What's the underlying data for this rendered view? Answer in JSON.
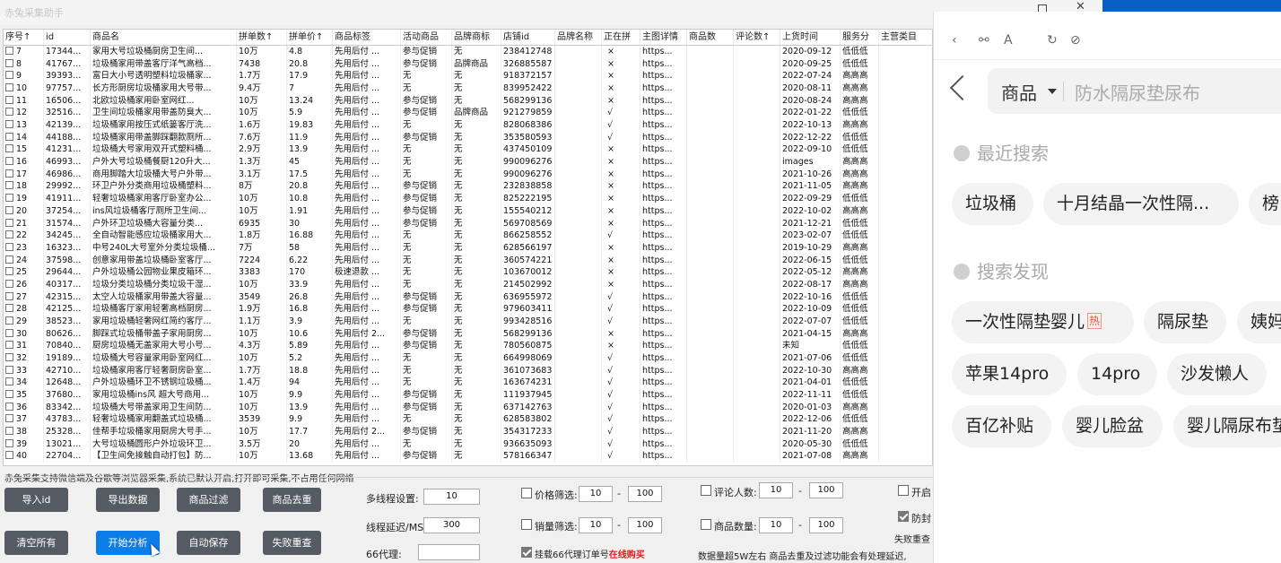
{
  "app": {
    "title": "赤兔采集助手"
  },
  "columns": [
    "序号↑",
    "id",
    "商品名",
    "拼单数↑",
    "拼单价↑",
    "商品标签",
    "活动商品",
    "品牌商标",
    "店铺id",
    "品牌名称",
    "正在拼",
    "主图详情",
    "商品数",
    "评论数↑",
    "上货时间",
    "服务分",
    "主营类目"
  ],
  "rows": [
    [
      "7",
      "17344...",
      "家用大号垃圾桶厨房卫生间...",
      "10万",
      "4.8",
      "先用后付 ...",
      "参与促销",
      "无",
      "238412748",
      "",
      "×",
      "https...",
      "",
      "",
      "2020-09-12",
      "低低低"
    ],
    [
      "8",
      "41767...",
      "垃圾桶家用带盖客厅洋气高档...",
      "7438",
      "20.8",
      "先用后付 ...",
      "参与促销",
      "品牌商品",
      "326885587",
      "",
      "×",
      "https...",
      "",
      "",
      "2020-09-25",
      "低低低"
    ],
    [
      "9",
      "39393...",
      "富日大小号透明塑料垃圾桶家...",
      "1.7万",
      "17.9",
      "先用后付 ...",
      "无",
      "无",
      "918372157",
      "",
      "×",
      "https...",
      "",
      "",
      "2022-07-24",
      "高高高"
    ],
    [
      "10",
      "97757...",
      "长方形厨房垃圾桶家用大号带...",
      "9.4万",
      "7",
      "先用后付 ...",
      "无",
      "无",
      "839952422",
      "",
      "×",
      "https...",
      "",
      "",
      "2020-08-11",
      "高高高"
    ],
    [
      "11",
      "16506...",
      "北欧垃圾桶家用卧室网红...",
      "10万",
      "13.24",
      "先用后付 ...",
      "参与促销",
      "无",
      "568299136",
      "",
      "×",
      "https...",
      "",
      "",
      "2020-08-24",
      "高高高"
    ],
    [
      "12",
      "32516...",
      "卫生间垃圾桶家用带盖防臭大...",
      "10万",
      "5.9",
      "先用后付 ...",
      "参与促销",
      "品牌商品",
      "921279859",
      "",
      "√",
      "https...",
      "",
      "",
      "2022-01-22",
      "低低低"
    ],
    [
      "13",
      "42139...",
      "垃圾桶家用按压式纸篓客厅洗...",
      "1.6万",
      "19.83",
      "先用后付 ...",
      "无",
      "无",
      "828068386",
      "",
      "√",
      "https...",
      "",
      "",
      "2022-10-13",
      "高高高"
    ],
    [
      "14",
      "44188...",
      "垃圾桶家用带盖脚踩翻款厕所...",
      "7.6万",
      "11.9",
      "先用后付 ...",
      "参与促销",
      "无",
      "353580593",
      "",
      "√",
      "https...",
      "",
      "",
      "2022-12-22",
      "低低低"
    ],
    [
      "15",
      "41231...",
      "垃圾桶大号家用双开式塑料桶...",
      "2.9万",
      "13.9",
      "先用后付 ...",
      "无",
      "无",
      "437450109",
      "",
      "×",
      "https...",
      "",
      "",
      "2022-09-10",
      "低低低"
    ],
    [
      "16",
      "46993...",
      "户外大号垃圾桶餐厨120升大...",
      "1.3万",
      "45",
      "先用后付 ...",
      "无",
      "无",
      "990096276",
      "",
      "×",
      "https...",
      "",
      "",
      "images",
      "高高高"
    ],
    [
      "17",
      "46986...",
      "商用脚踏大垃圾桶大号户外带...",
      "3.1万",
      "17.5",
      "先用后付 ...",
      "无",
      "无",
      "990096276",
      "",
      "×",
      "https...",
      "",
      "",
      "2021-10-26",
      "高高高"
    ],
    [
      "18",
      "29992...",
      "环卫户外分类商用垃圾桶塑料...",
      "8万",
      "20.8",
      "先用后付 ...",
      "参与促销",
      "无",
      "232838858",
      "",
      "×",
      "https...",
      "",
      "",
      "2021-11-05",
      "高高高"
    ],
    [
      "19",
      "41911...",
      "轻奢垃圾桶家用客厅卧室办公...",
      "10万",
      "10.8",
      "先用后付 ...",
      "参与促销",
      "无",
      "825222195",
      "",
      "×",
      "https...",
      "",
      "",
      "2022-09-29",
      "低低低"
    ],
    [
      "20",
      "37254...",
      "ins风垃圾桶客厅厕所卫生间...",
      "10万",
      "1.91",
      "先用后付 ...",
      "参与促销",
      "无",
      "155540212",
      "",
      "×",
      "https...",
      "",
      "",
      "2022-10-02",
      "高高高"
    ],
    [
      "21",
      "31574...",
      "户外环卫垃圾桶大容量分类...",
      "6935",
      "30",
      "先用后付 ...",
      "参与促销",
      "无",
      "569708569",
      "",
      "×",
      "https...",
      "",
      "",
      "2021-12-21",
      "低低低"
    ],
    [
      "22",
      "34245...",
      "全自动智能感应垃圾桶家用大...",
      "1.8万",
      "16.88",
      "先用后付 ...",
      "无",
      "无",
      "866258552",
      "",
      "√",
      "https...",
      "",
      "",
      "2023-02-07",
      "低低低"
    ],
    [
      "23",
      "16323...",
      "中号240L大号室外分类垃圾桶...",
      "7万",
      "58",
      "先用后付 ...",
      "无",
      "无",
      "628566197",
      "",
      "×",
      "https...",
      "",
      "",
      "2019-10-29",
      "高高高"
    ],
    [
      "24",
      "37598...",
      "创意家用带盖垃圾桶卧室客厅...",
      "7224",
      "6.22",
      "先用后付 ...",
      "无",
      "无",
      "360574221",
      "",
      "×",
      "https...",
      "",
      "",
      "2022-06-15",
      "低低低"
    ],
    [
      "25",
      "29644...",
      "户外垃圾桶公园物业果皮箱环...",
      "3383",
      "170",
      "极速退款 ...",
      "无",
      "无",
      "103670012",
      "",
      "×",
      "https...",
      "",
      "",
      "2022-05-12",
      "高高高"
    ],
    [
      "26",
      "40317...",
      "垃圾分类垃圾桶分类垃圾干湿...",
      "10万",
      "33.9",
      "先用后付 ...",
      "无",
      "无",
      "214502992",
      "",
      "×",
      "https...",
      "",
      "",
      "2022-08-17",
      "高高高"
    ],
    [
      "27",
      "42315...",
      "太空人垃圾桶家用带盖大容量...",
      "3549",
      "26.8",
      "先用后付 ...",
      "参与促销",
      "无",
      "636955972",
      "",
      "√",
      "https...",
      "",
      "",
      "2022-10-16",
      "低低低"
    ],
    [
      "28",
      "42125...",
      "垃圾桶客厅家用轻奢高档厨房...",
      "1.9万",
      "16.8",
      "先用后付 ...",
      "参与促销",
      "无",
      "979603411",
      "",
      "√",
      "https...",
      "",
      "",
      "2022-10-09",
      "低低低"
    ],
    [
      "29",
      "38523...",
      "家用垃圾桶轻奢网红简约客厅...",
      "1.1万",
      "3.9",
      "先用后付 ...",
      "无",
      "无",
      "993428516",
      "",
      "√",
      "https...",
      "",
      "",
      "2022-07-07",
      "低低低"
    ],
    [
      "30",
      "80626...",
      "脚踩式垃圾桶带盖子家用厨房...",
      "10万",
      "10.6",
      "先用后付 2...",
      "参与促销",
      "无",
      "568299136",
      "",
      "×",
      "https...",
      "",
      "",
      "2021-04-15",
      "高高高"
    ],
    [
      "31",
      "70840...",
      "厨房垃圾桶无盖家用大号小号...",
      "4.3万",
      "5.89",
      "先用后付 ...",
      "参与促销",
      "无",
      "780560875",
      "",
      "×",
      "https...",
      "",
      "",
      "未知",
      "低低低"
    ],
    [
      "32",
      "19189...",
      "垃圾桶大号容量家用卧室网红...",
      "10万",
      "5.2",
      "先用后付 ...",
      "无",
      "无",
      "664998069",
      "",
      "√",
      "https...",
      "",
      "",
      "2021-07-06",
      "低低低"
    ],
    [
      "33",
      "42710...",
      "垃圾桶家用客厅轻奢厨房卧室...",
      "1.7万",
      "18.8",
      "先用后付 ...",
      "无",
      "无",
      "361073683",
      "",
      "√",
      "https...",
      "",
      "",
      "2022-10-30",
      "高高高"
    ],
    [
      "34",
      "12648...",
      "户外垃圾桶环卫不锈钢垃圾桶...",
      "1.4万",
      "94",
      "先用后付 ...",
      "无",
      "无",
      "163674231",
      "",
      "√",
      "https...",
      "",
      "",
      "2021-04-01",
      "低低低"
    ],
    [
      "35",
      "37680...",
      "家用垃圾桶ins风 超大号商用...",
      "10万",
      "9.9",
      "先用后付 ...",
      "参与促销",
      "无",
      "111937945",
      "",
      "√",
      "https...",
      "",
      "",
      "2022-11-11",
      "低低低"
    ],
    [
      "36",
      "83342...",
      "垃圾桶大号带盖家用卫生间防...",
      "10万",
      "13.9",
      "先用后付 ...",
      "参与促销",
      "无",
      "637142763",
      "",
      "√",
      "https...",
      "",
      "",
      "2020-01-03",
      "高高高"
    ],
    [
      "37",
      "43783...",
      "轻奢垃圾桶家用翻盖式垃圾桶...",
      "3539",
      "9.9",
      "先用后付 ...",
      "无",
      "无",
      "628583802",
      "",
      "√",
      "https...",
      "",
      "",
      "2022-12-06",
      "低低低"
    ],
    [
      "38",
      "25328...",
      "佳帮手垃圾桶家用厨房大号手...",
      "10万",
      "17.7",
      "先用后付 2...",
      "参与促销",
      "无",
      "354317233",
      "",
      "√",
      "https...",
      "",
      "",
      "2021-11-20",
      "高高高"
    ],
    [
      "39",
      "13021...",
      "大号垃圾桶圆形户外垃圾环卫...",
      "3.5万",
      "20",
      "先用后付 ...",
      "无",
      "无",
      "936635093",
      "",
      "√",
      "https...",
      "",
      "",
      "2020-05-30",
      "低低低"
    ],
    [
      "40",
      "22704...",
      "【卫生间免接触自动打包】防...",
      "10万",
      "13.68",
      "先用后付 ...",
      "参与促销",
      "无",
      "578166347",
      "",
      "√",
      "https...",
      "",
      "",
      "2021-07-08",
      "高高高"
    ]
  ],
  "notice": "赤兔采集支持微信端及谷歌等浏览器采集,系统已默认开启,打开即可采集,不占用任何网络",
  "buttons": {
    "import_id": "导入id",
    "export": "导出数据",
    "filter": "商品过滤",
    "dedupe": "商品去重",
    "clear": "清空所有",
    "start": "开始分析",
    "autosave": "自动保存",
    "retry": "失败重查"
  },
  "settings": {
    "threads_label": "多线程设置:",
    "threads_value": "10",
    "delay_label": "线程延迟/MS:",
    "delay_value": "300",
    "proxy_label": "66代理:",
    "proxy_value": "",
    "price_label": "价格筛选:",
    "price_min": "10",
    "price_max": "100",
    "sales_label": "销量筛选:",
    "sales_min": "10",
    "sales_max": "100",
    "reviews_label": "评论人数:",
    "reviews_min": "10",
    "reviews_max": "100",
    "count_label": "商品数量:",
    "count_min": "10",
    "count_max": "100",
    "dash": "-",
    "enable_label": "开启",
    "anti_label": "防封",
    "fail_label": "失败重查",
    "proxy_mount_label": "挂载66代理订单号",
    "buy_online": "在线购买",
    "note": "数据量超5W左右 商品去重及过滤功能会有处理延迟,"
  },
  "panel": {
    "search_type": "商品",
    "search_query": "防水隔尿垫尿布",
    "recent_title": "最近搜索",
    "recent": [
      "垃圾桶",
      "十月结晶一次性隔...",
      "榜"
    ],
    "discover_title": "搜索发现",
    "discover_row1": [
      "一次性隔垫婴儿",
      "隔尿垫",
      "姨妈"
    ],
    "hot_badge": "热",
    "discover_row2": [
      "苹果14pro",
      "14pro",
      "沙发懒人"
    ],
    "discover_row3": [
      "百亿补贴",
      "婴儿脸盆",
      "婴儿隔尿布垫"
    ]
  }
}
